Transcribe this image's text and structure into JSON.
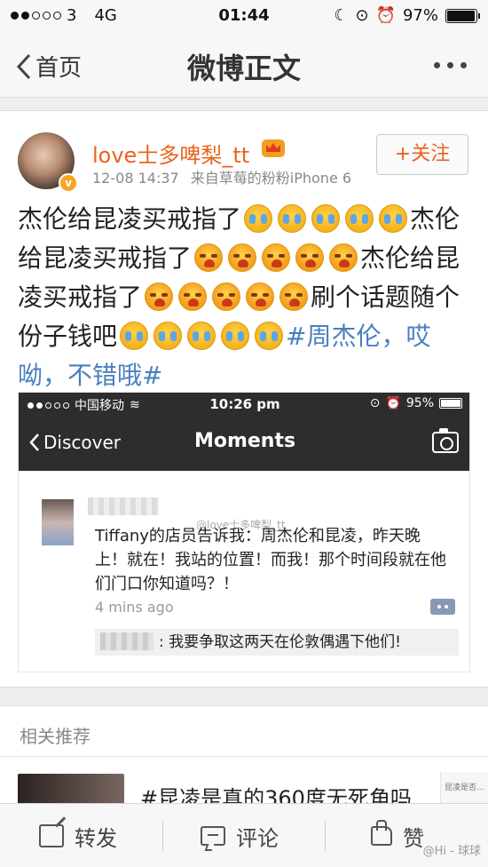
{
  "status_bar": {
    "carrier_signal": "3",
    "network": "4G",
    "time": "01:44",
    "battery": "97%",
    "battery_level": 0.97
  },
  "nav": {
    "back_label": "首页",
    "title": "微博正文"
  },
  "post": {
    "username": "love士多啤梨_tt",
    "time": "12-08 14:37",
    "source": "来自草莓的粉粉iPhone 6",
    "follow_label": "+关注",
    "text_1": "杰伦给昆凌买戒指了",
    "text_2": "杰伦给昆凌买戒指了",
    "text_3": "杰伦给昆凌买戒指了",
    "text_4": "刷个话题随个份子钱吧",
    "hashtag": "#周杰伦，哎呦，不错哦#"
  },
  "embed": {
    "carrier": "中国移动",
    "time": "10:26 pm",
    "battery": "95%",
    "back_label": "Discover",
    "title": "Moments",
    "watermark": "@love士多啤梨_tt",
    "moment_text": "Tiffany的店员告诉我：周杰伦和昆凌，昨天晚上！就在！我站的位置！而我！那个时间段就在他们门口你知道吗？！",
    "time_ago": "4 mins ago",
    "reply_text": ": 我要争取这两天在伦敦偶遇下他们!"
  },
  "related": {
    "title": "相关推荐",
    "item_title": "#昆凌是真的360度无死角吗",
    "side_text": "昆凌是否..."
  },
  "bottom_bar": {
    "repost_label": "转发",
    "comment_label": "评论",
    "like_label": "赞",
    "watermark": "@Hi - 球球"
  },
  "colors": {
    "username": "#e8641b",
    "hashtag": "#4a7fbf",
    "embed_header": "#2d2d2d"
  }
}
